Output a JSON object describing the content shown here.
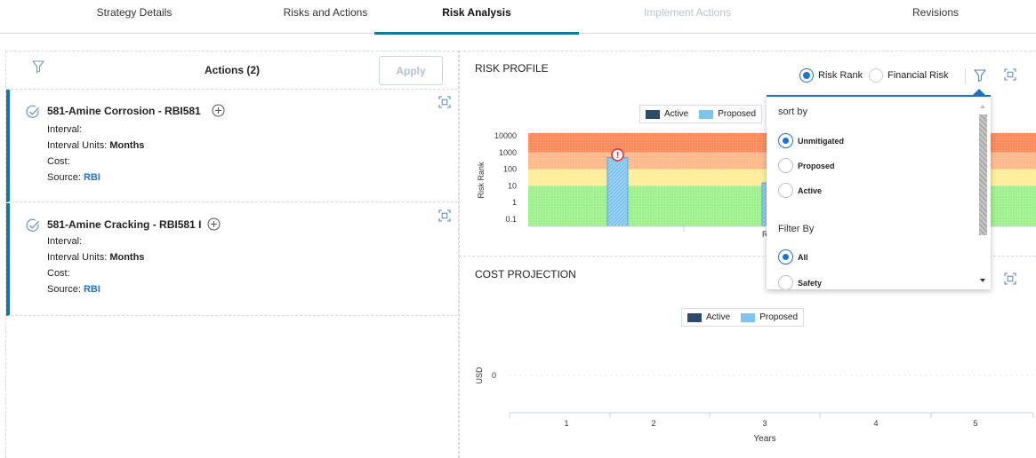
{
  "tabs": [
    {
      "label": "Strategy Details",
      "state": "normal"
    },
    {
      "label": "Risks and Actions",
      "state": "normal"
    },
    {
      "label": "Risk Analysis",
      "state": "active"
    },
    {
      "label": "Implement Actions",
      "state": "disabled"
    },
    {
      "label": "Revisions",
      "state": "normal"
    }
  ],
  "actions_panel": {
    "title": "Actions (2)",
    "apply_label": "Apply",
    "filter_icon": "filter-icon",
    "cards": [
      {
        "title": "581-Amine Corrosion - RBI581",
        "interval_label": "Interval:",
        "interval_units_label": "Interval Units:",
        "interval_units_value": "Months",
        "cost_label": "Cost:",
        "source_label": "Source:",
        "source_value": "RBI"
      },
      {
        "title": "581-Amine Cracking - RBI581 I",
        "interval_label": "Interval:",
        "interval_units_label": "Interval Units:",
        "interval_units_value": "Months",
        "cost_label": "Cost:",
        "source_label": "Source:",
        "source_value": "RBI"
      }
    ]
  },
  "risk_profile": {
    "title": "RISK PROFILE",
    "options": [
      {
        "label": "Risk Rank",
        "selected": true
      },
      {
        "label": "Financial Risk",
        "selected": false
      }
    ],
    "legend": [
      "Active",
      "Proposed"
    ]
  },
  "cost_projection": {
    "title": "COST PROJECTION",
    "legend": [
      "Active",
      "Proposed"
    ]
  },
  "sort_dropdown": {
    "sort_label": "sort by",
    "sort_options": [
      {
        "label": "Unmitigated",
        "selected": true
      },
      {
        "label": "Proposed",
        "selected": false
      },
      {
        "label": "Active",
        "selected": false
      }
    ],
    "filter_label": "Filter By",
    "filter_options": [
      {
        "label": "All",
        "selected": true
      },
      {
        "label": "Safety",
        "selected": false
      }
    ]
  },
  "chart_data": [
    {
      "type": "bar",
      "title": "RISK PROFILE",
      "ylabel": "Risk Rank",
      "yscale": "log",
      "yticks": [
        "10000",
        "1000",
        "100",
        "10",
        "1",
        "0.1"
      ],
      "ylim": [
        0.1,
        10000
      ],
      "x_tick_partial": "R",
      "series": [
        {
          "name": "Active",
          "color": "#2e4a6b",
          "values": []
        },
        {
          "name": "Proposed",
          "color": "#7fc3ef",
          "values": [
            500,
            15
          ]
        }
      ],
      "bands": [
        {
          "color": "#ff8a5c",
          "from": 1000,
          "to": 10000
        },
        {
          "color": "#ffb98a",
          "from": 100,
          "to": 1000
        },
        {
          "color": "#ffee99",
          "from": 10,
          "to": 100
        },
        {
          "color": "#9ff08f",
          "from": 0.1,
          "to": 10
        }
      ],
      "alert_marker": "!"
    },
    {
      "type": "bar",
      "title": "COST PROJECTION",
      "xlabel": "Years",
      "ylabel": "USD",
      "categories": [
        "1",
        "2",
        "3",
        "4",
        "5"
      ],
      "yticks": [
        "0"
      ],
      "series": [
        {
          "name": "Active",
          "color": "#2e4a6b",
          "values": [
            0,
            0,
            0,
            0,
            0
          ]
        },
        {
          "name": "Proposed",
          "color": "#7fc3ef",
          "values": [
            0,
            0,
            0,
            0,
            0
          ]
        }
      ]
    }
  ]
}
